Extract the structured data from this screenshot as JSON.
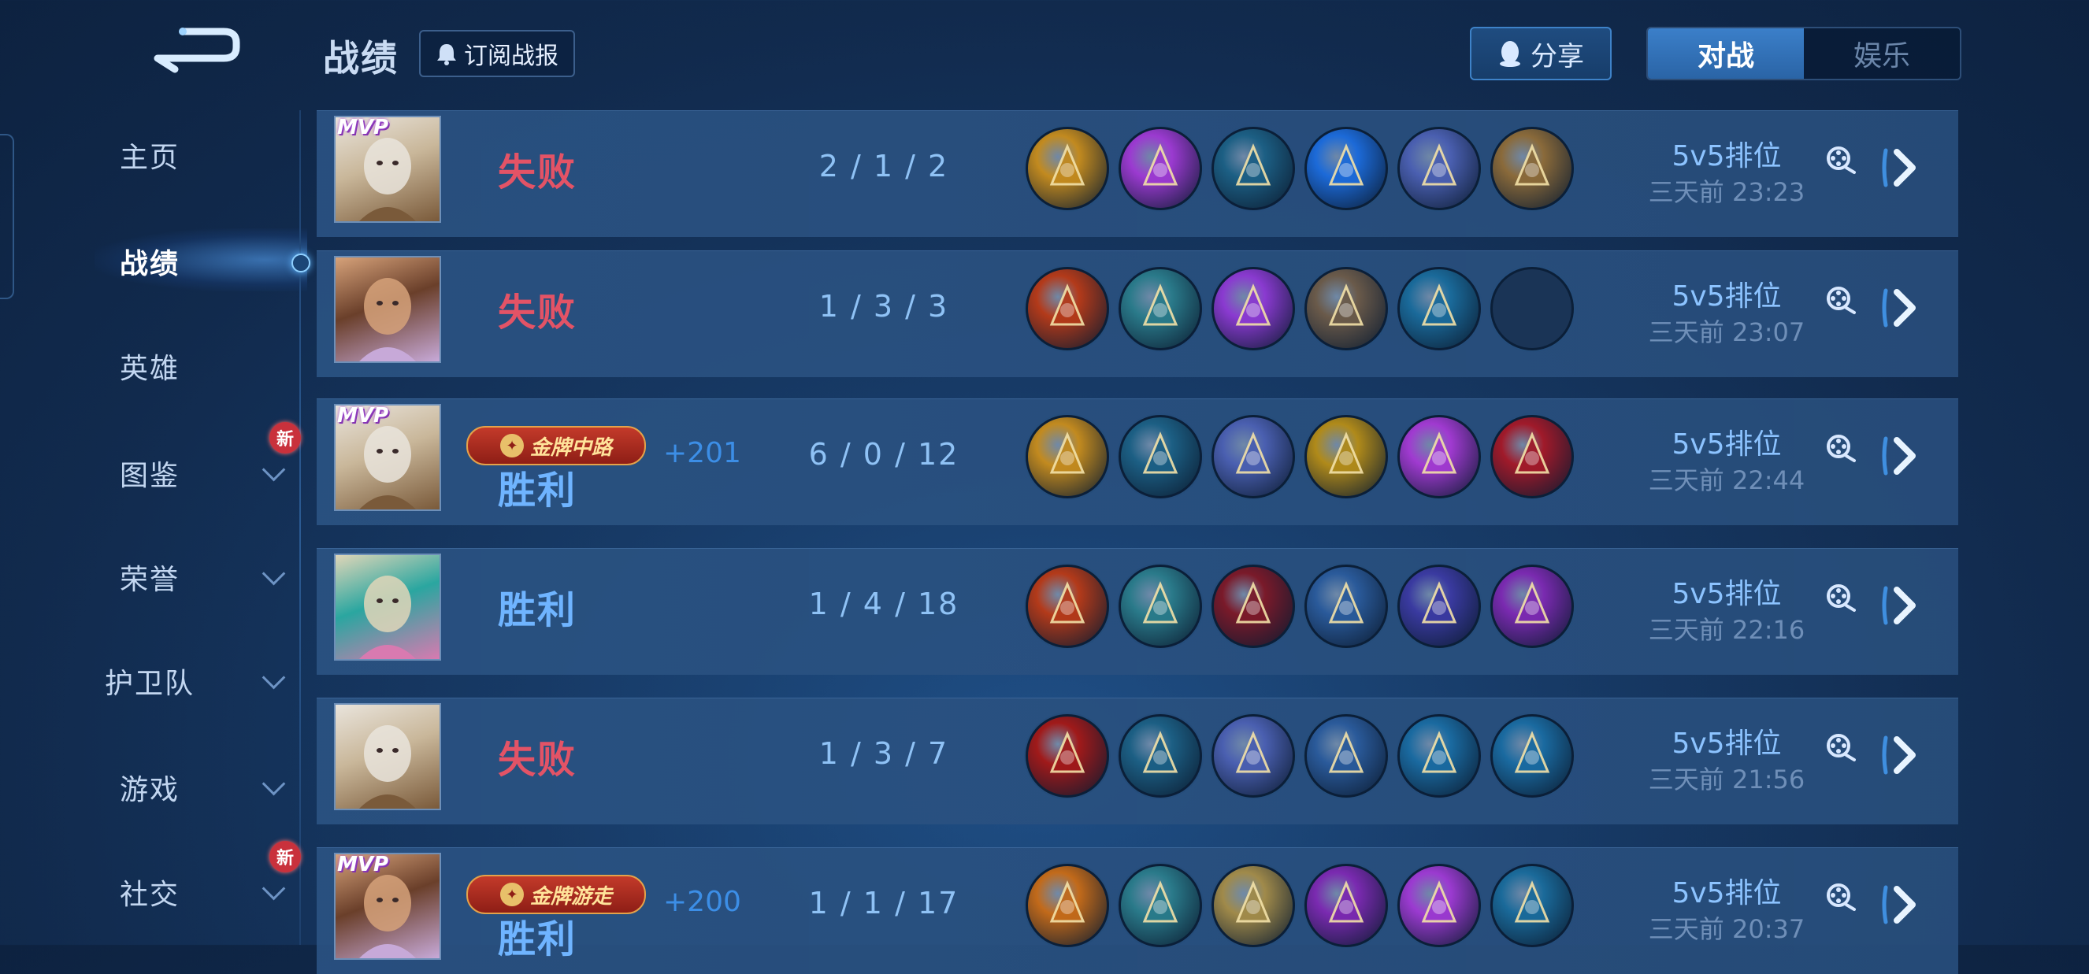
{
  "header": {
    "title": "战绩",
    "subscribe_label": "订阅战报",
    "share_label": "分享",
    "tabs": [
      {
        "label": "对战",
        "active": true
      },
      {
        "label": "娱乐",
        "active": false
      }
    ]
  },
  "sidebar": {
    "items": [
      {
        "label": "主页",
        "active": false,
        "has_chevron": false,
        "new_badge": ""
      },
      {
        "label": "战绩",
        "active": true,
        "has_chevron": false,
        "new_badge": ""
      },
      {
        "label": "英雄",
        "active": false,
        "has_chevron": false,
        "new_badge": ""
      },
      {
        "label": "图鉴",
        "active": false,
        "has_chevron": true,
        "new_badge": "新"
      },
      {
        "label": "荣誉",
        "active": false,
        "has_chevron": true,
        "new_badge": ""
      },
      {
        "label": "护卫队",
        "active": false,
        "has_chevron": true,
        "new_badge": ""
      },
      {
        "label": "游戏",
        "active": false,
        "has_chevron": true,
        "new_badge": ""
      },
      {
        "label": "社交",
        "active": false,
        "has_chevron": true,
        "new_badge": "新"
      }
    ]
  },
  "matches": [
    {
      "hero": "hero-warrior",
      "mvp": "MVP",
      "badge": "",
      "result": "失败",
      "outcome": "lose",
      "points": "",
      "kda": "2 / 1 / 2",
      "items": [
        "#c28a1f",
        "#9b3ad0",
        "#1c5f84",
        "#1c6ad8",
        "#4a5fb0",
        "#8a6a3a"
      ],
      "mode": "5v5排位",
      "time": "三天前 23:23"
    },
    {
      "hero": "hero-mage",
      "mvp": "",
      "badge": "",
      "result": "失败",
      "outcome": "lose",
      "points": "",
      "kda": "1 / 3 / 3",
      "items": [
        "#b33a1a",
        "#2a7a8a",
        "#8a3ad0",
        "#6a5a4a",
        "#1a6a9a",
        ""
      ],
      "mode": "5v5排位",
      "time": "三天前 23:07"
    },
    {
      "hero": "hero-warrior",
      "mvp": "MVP",
      "badge": "金牌中路",
      "result": "胜利",
      "outcome": "win",
      "points": "+201",
      "kda": "6 / 0 / 12",
      "items": [
        "#c28a1f",
        "#1c5f84",
        "#4a5fb0",
        "#b08a1a",
        "#a03ad0",
        "#a01a2a"
      ],
      "mode": "5v5排位",
      "time": "三天前 22:44"
    },
    {
      "hero": "hero-support",
      "mvp": "",
      "badge": "",
      "result": "胜利",
      "outcome": "win",
      "points": "",
      "kda": "1 / 4 / 18",
      "items": [
        "#b33a1a",
        "#2a7a8a",
        "#7a1a2a",
        "#2a5a9a",
        "#3a3aa0",
        "#7a2ab0"
      ],
      "mode": "5v5排位",
      "time": "三天前 22:16"
    },
    {
      "hero": "hero-warrior",
      "mvp": "",
      "badge": "",
      "result": "失败",
      "outcome": "lose",
      "points": "",
      "kda": "1 / 3 / 7",
      "items": [
        "#a01a1a",
        "#1c5f84",
        "#4a5fb0",
        "#2a5a9a",
        "#1a6aa0",
        "#1a6aa0"
      ],
      "mode": "5v5排位",
      "time": "三天前 21:56"
    },
    {
      "hero": "hero-mage",
      "mvp": "MVP",
      "badge": "金牌游走",
      "result": "胜利",
      "outcome": "win",
      "points": "+200",
      "kda": "1 / 1 / 17",
      "items": [
        "#c26a1a",
        "#2a7a8a",
        "#a08a4a",
        "#7a2ab0",
        "#9b3ad0",
        "#1a6a9a"
      ],
      "mode": "5v5排位",
      "time": "三天前 20:37"
    }
  ]
}
